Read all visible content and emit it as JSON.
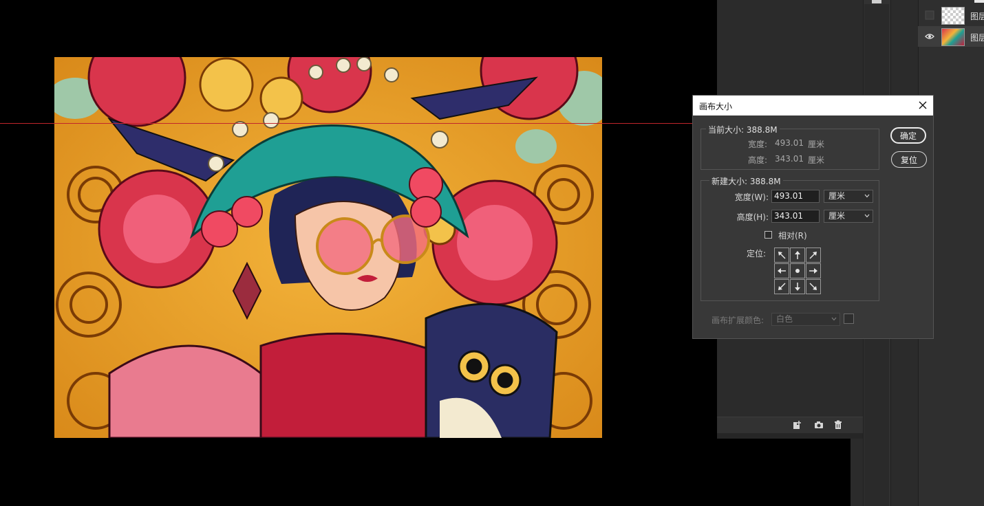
{
  "layers": [
    {
      "name": "图层",
      "visible": false,
      "thumb": "transparent-checker"
    },
    {
      "name": "图层",
      "visible": true,
      "thumb": "artwork"
    }
  ],
  "history_footer_icons": [
    "new-document-from-state-icon",
    "snapshot-camera-icon",
    "trash-icon"
  ],
  "dialog": {
    "title": "画布大小",
    "ok_label": "确定",
    "reset_label": "复位",
    "current": {
      "legend": "当前大小: 388.8M",
      "width_label": "宽度:",
      "width_value": "493.01",
      "height_label": "高度:",
      "height_value": "343.01",
      "unit": "厘米"
    },
    "new": {
      "legend": "新建大小: 388.8M",
      "width_label": "宽度(W):",
      "width_value": "493.01",
      "height_label": "高度(H):",
      "height_value": "343.01",
      "unit_width": "厘米",
      "unit_height": "厘米",
      "relative_label": "相对(R)",
      "relative_checked": false,
      "anchor_label": "定位:",
      "anchor_selected": "center"
    },
    "extension_color_label": "画布扩展颜色:",
    "extension_color_value": "白色"
  },
  "colors": {
    "guide": "#c0262b",
    "dialog_bg": "#383838",
    "panel_bg": "#2b2b2b"
  }
}
